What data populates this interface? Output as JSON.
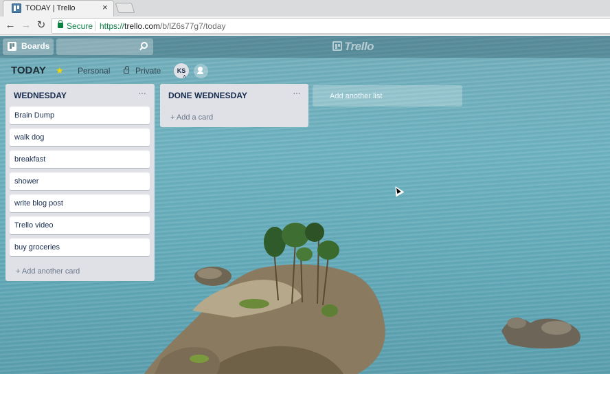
{
  "browser": {
    "tab_title": "TODAY | Trello",
    "tab_close": "×",
    "secure_label": "Secure",
    "url_scheme": "https://",
    "url_host": "trello.com",
    "url_path": "/b/lZ6s77g7/today",
    "icons": {
      "back": "back-arrow-icon",
      "forward": "forward-arrow-icon",
      "reload": "reload-icon",
      "lock": "lock-icon"
    }
  },
  "header": {
    "boards_label": "Boards",
    "search_placeholder": "",
    "logo_text": "Trello"
  },
  "board": {
    "title": "TODAY",
    "team": "Personal",
    "visibility": "Private",
    "member_initials": "KS",
    "star_color": "#f2d600"
  },
  "lists": [
    {
      "title": "WEDNESDAY",
      "menu": "···",
      "cards": [
        "Brain Dump",
        "walk dog",
        "breakfast",
        "shower",
        "write blog post",
        "Trello video",
        "buy groceries"
      ],
      "add_label": "+ Add another card"
    },
    {
      "title": "DONE WEDNESDAY",
      "menu": "···",
      "cards": [],
      "add_label": "+ Add a card"
    }
  ],
  "add_list_label": "Add another list"
}
